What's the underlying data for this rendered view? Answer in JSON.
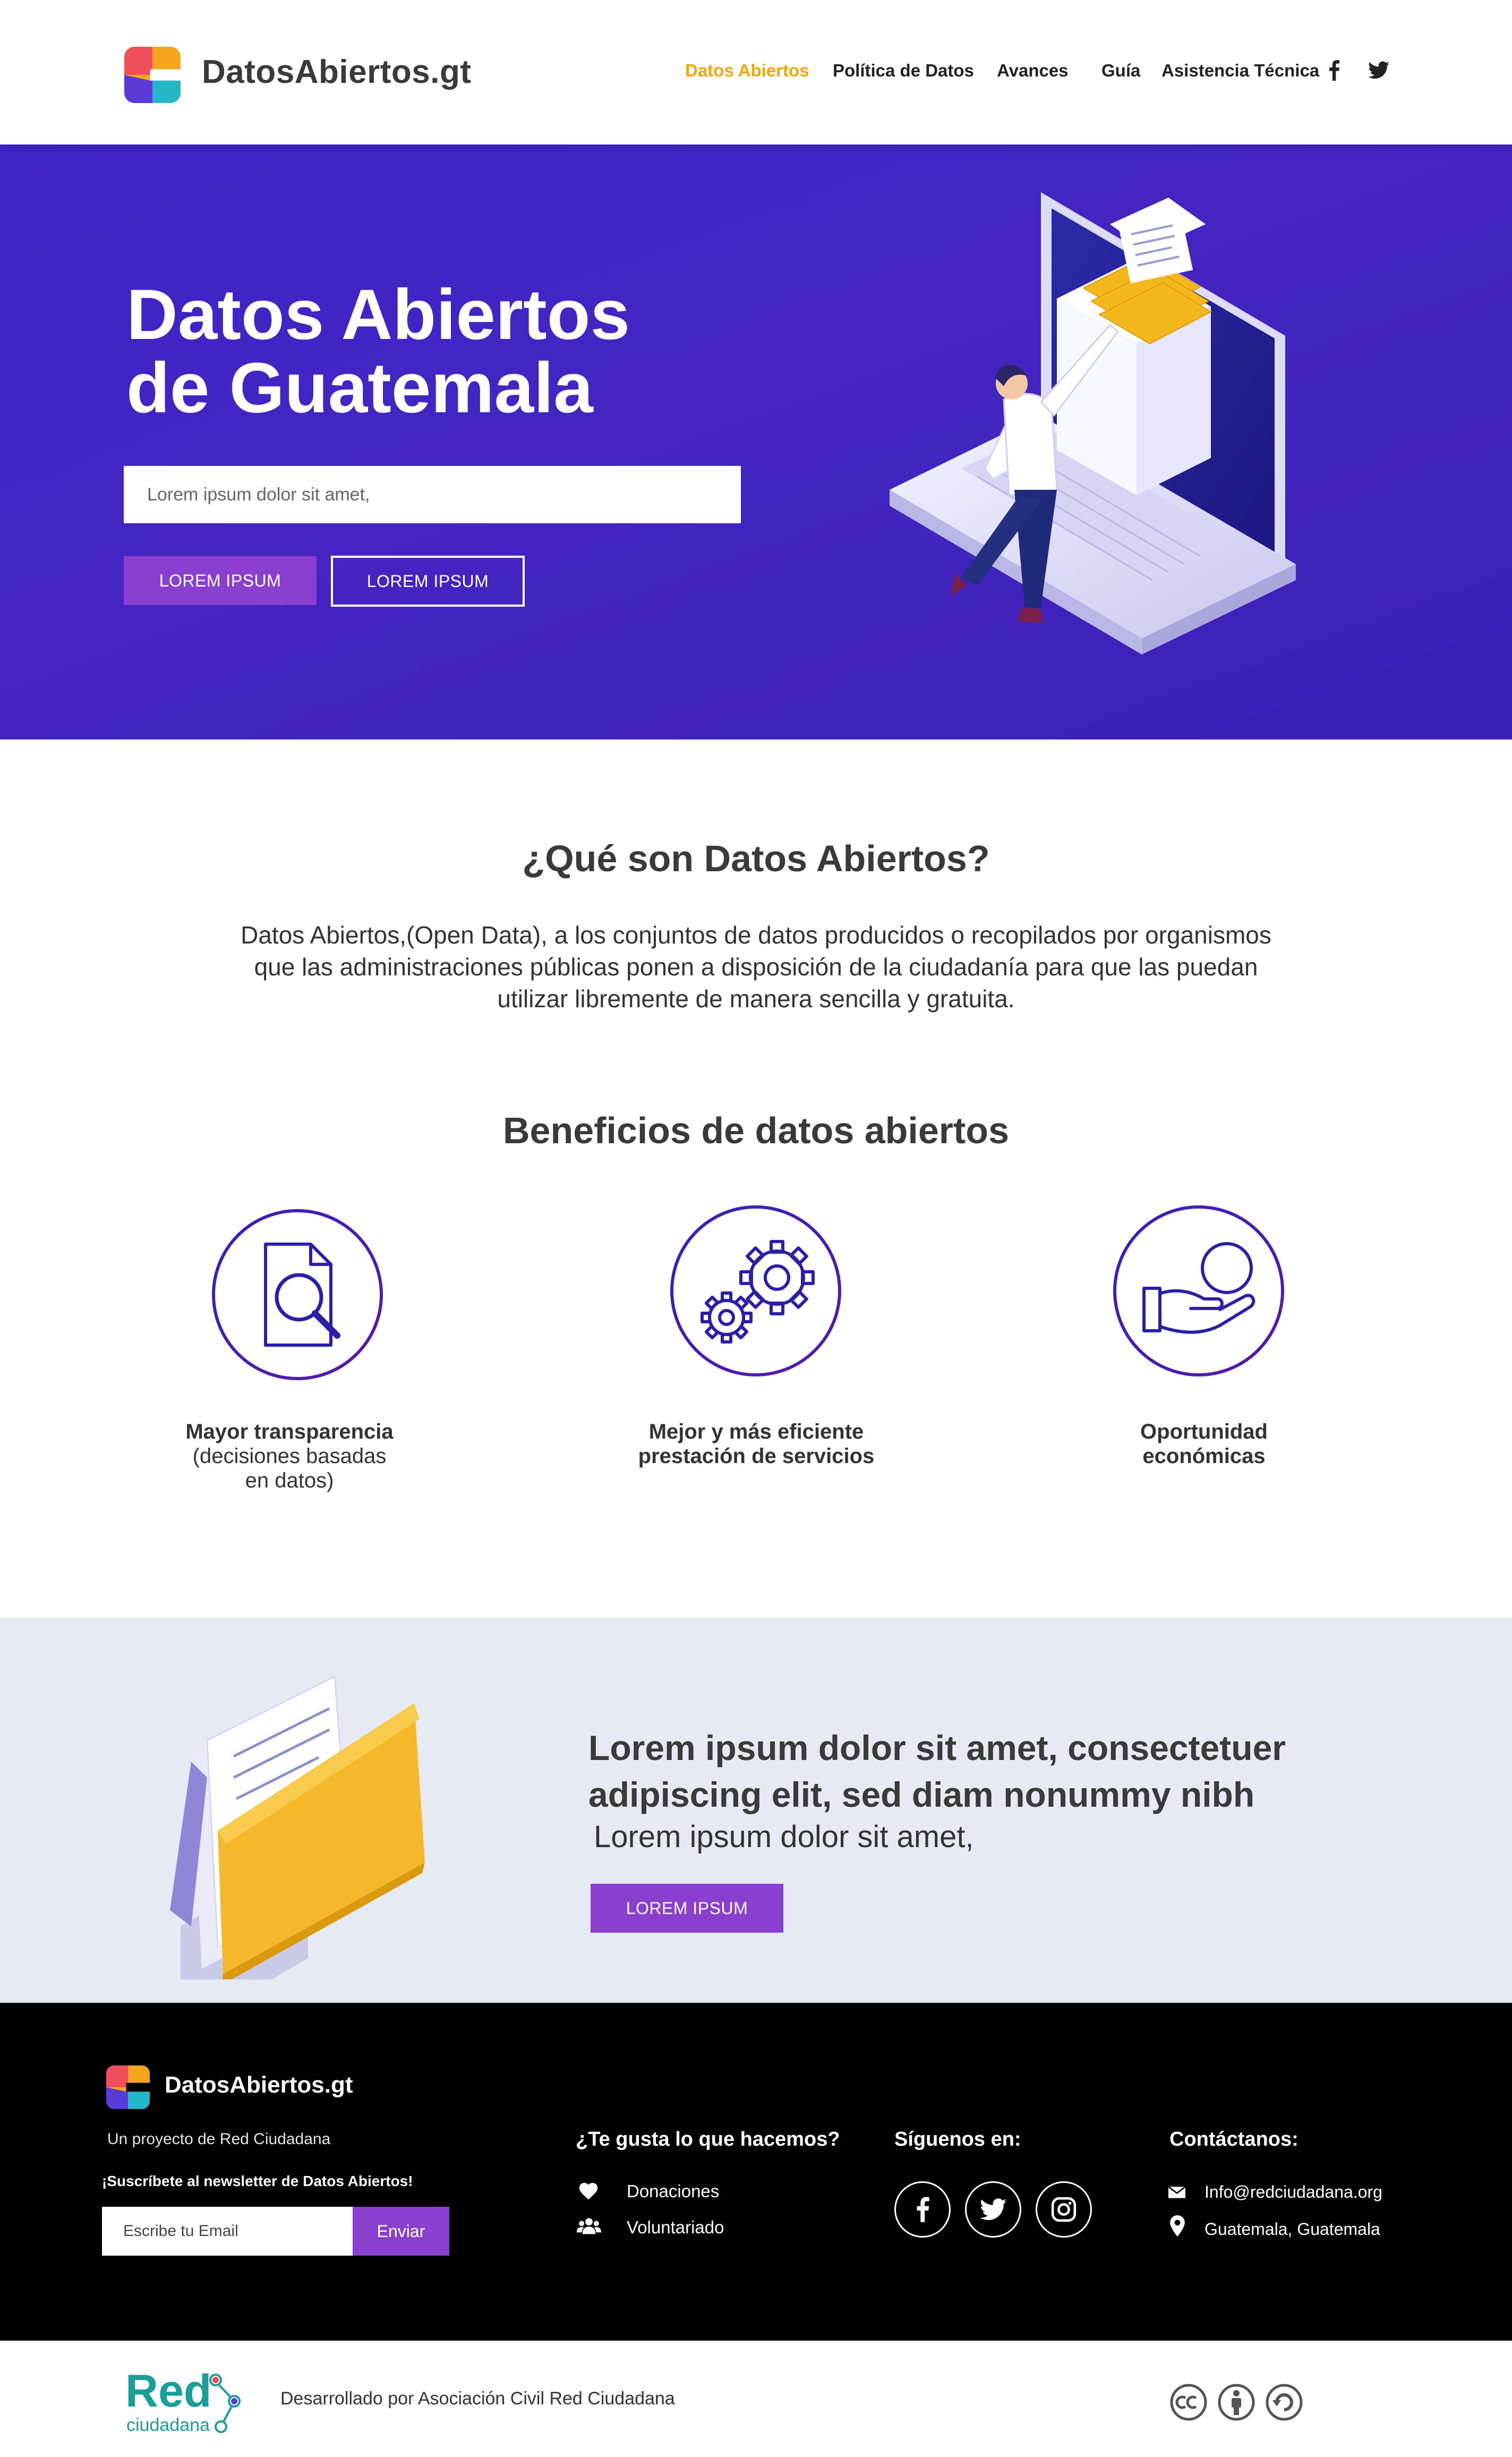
{
  "brand": {
    "name": "DatosAbiertos.gt",
    "colors": {
      "orange": "#f2a800",
      "purple": "#8b3fcf",
      "hero_blue": "#4425c2",
      "dark_text": "#3a3a3a"
    }
  },
  "nav": {
    "items": [
      {
        "label": "Datos Abiertos",
        "active": true
      },
      {
        "label": "Política de Datos",
        "active": false
      },
      {
        "label": "Avances",
        "active": false
      },
      {
        "label": "Guía",
        "active": false
      },
      {
        "label": "Asistencia Técnica",
        "active": false
      }
    ],
    "social_icons": [
      "facebook-icon",
      "twitter-icon"
    ]
  },
  "hero": {
    "title_line1": "Datos Abiertos",
    "title_line2": "de Guatemala",
    "search_placeholder": "Lorem ipsum dolor sit amet,",
    "primary_button": "LOREM IPSUM",
    "secondary_button": "LOREM IPSUM"
  },
  "about": {
    "title": "¿Qué son Datos Abiertos?",
    "text_line1": "Datos Abiertos,(Open Data), a los conjuntos de datos producidos o recopilados por organismos",
    "text_line2": "que las administraciones públicas ponen a disposición de la ciudadanía para que las puedan",
    "text_line3": "utilizar libremente de manera sencilla y gratuita."
  },
  "benefits": {
    "title": "Beneficios de datos abiertos",
    "items": [
      {
        "icon": "document-search-icon",
        "line1": "Mayor transparencia",
        "line2": "(decisiones basadas",
        "line3": "en datos)"
      },
      {
        "icon": "gears-icon",
        "line1": "Mejor y más eficiente",
        "line2": "prestación de servicios",
        "line3": ""
      },
      {
        "icon": "hand-coin-icon",
        "line1": "Oportunidad",
        "line2": "económicas",
        "line3": ""
      }
    ]
  },
  "cta": {
    "heading_line1": "Lorem ipsum dolor sit amet, consectetuer",
    "heading_line2": "adipiscing elit, sed diam nonummy nibh",
    "subtext": "Lorem ipsum dolor sit amet,",
    "button": "LOREM IPSUM"
  },
  "footer": {
    "brand": "DatosAbiertos.gt",
    "project": "Un proyecto de Red Ciudadana",
    "newsletter_label": "¡Suscríbete al newsletter de Datos Abiertos!",
    "email_placeholder": "Escribe tu Email",
    "send_button": "Enviar",
    "like_title": "¿Te gusta lo que hacemos?",
    "donate": "Donaciones",
    "volunteer": "Voluntariado",
    "follow_title": "Síguenos en:",
    "follow_icons": [
      "facebook-icon",
      "twitter-icon",
      "instagram-icon"
    ],
    "contact_title": "Contáctanos:",
    "email": "Info@redciudadana.org",
    "location": "Guatemala, Guatemala"
  },
  "bottom": {
    "logo_word": "Red",
    "logo_sub": "ciudadana",
    "developed_by": "Desarrollado por Asociación Civil Red Ciudadana",
    "license_icons": [
      "cc-icon",
      "by-icon",
      "sa-icon"
    ]
  }
}
